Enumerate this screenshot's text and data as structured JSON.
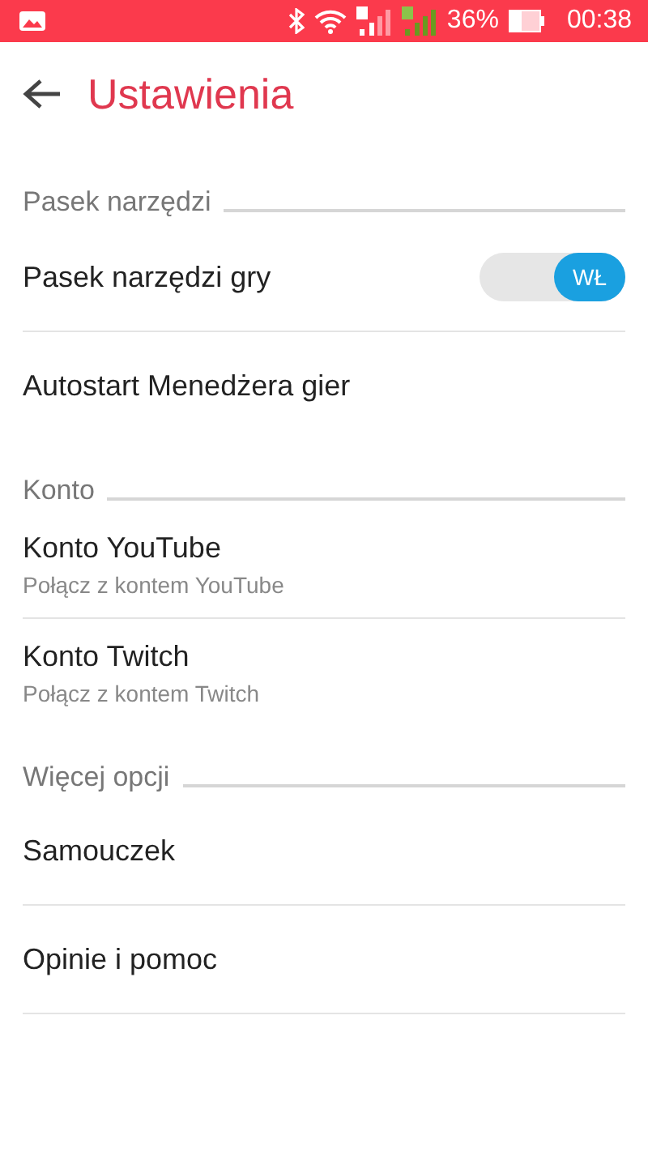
{
  "status_bar": {
    "battery": "36%",
    "time": "00:38"
  },
  "header": {
    "title": "Ustawienia"
  },
  "sections": [
    {
      "title": "Pasek narzędzi",
      "items": [
        {
          "kind": "toggle",
          "label": "Pasek narzędzi gry",
          "on": true,
          "switch_label": "WŁ"
        },
        {
          "kind": "plain",
          "label": "Autostart Menedżera gier"
        }
      ]
    },
    {
      "title": "Konto",
      "items": [
        {
          "kind": "subtitle",
          "label": "Konto YouTube",
          "subtitle": "Połącz z kontem YouTube"
        },
        {
          "kind": "subtitle",
          "label": "Konto Twitch",
          "subtitle": "Połącz z kontem Twitch"
        }
      ]
    },
    {
      "title": "Więcej opcji",
      "items": [
        {
          "kind": "plain",
          "label": "Samouczek"
        },
        {
          "kind": "plain",
          "label": "Opinie i pomoc"
        }
      ]
    }
  ]
}
